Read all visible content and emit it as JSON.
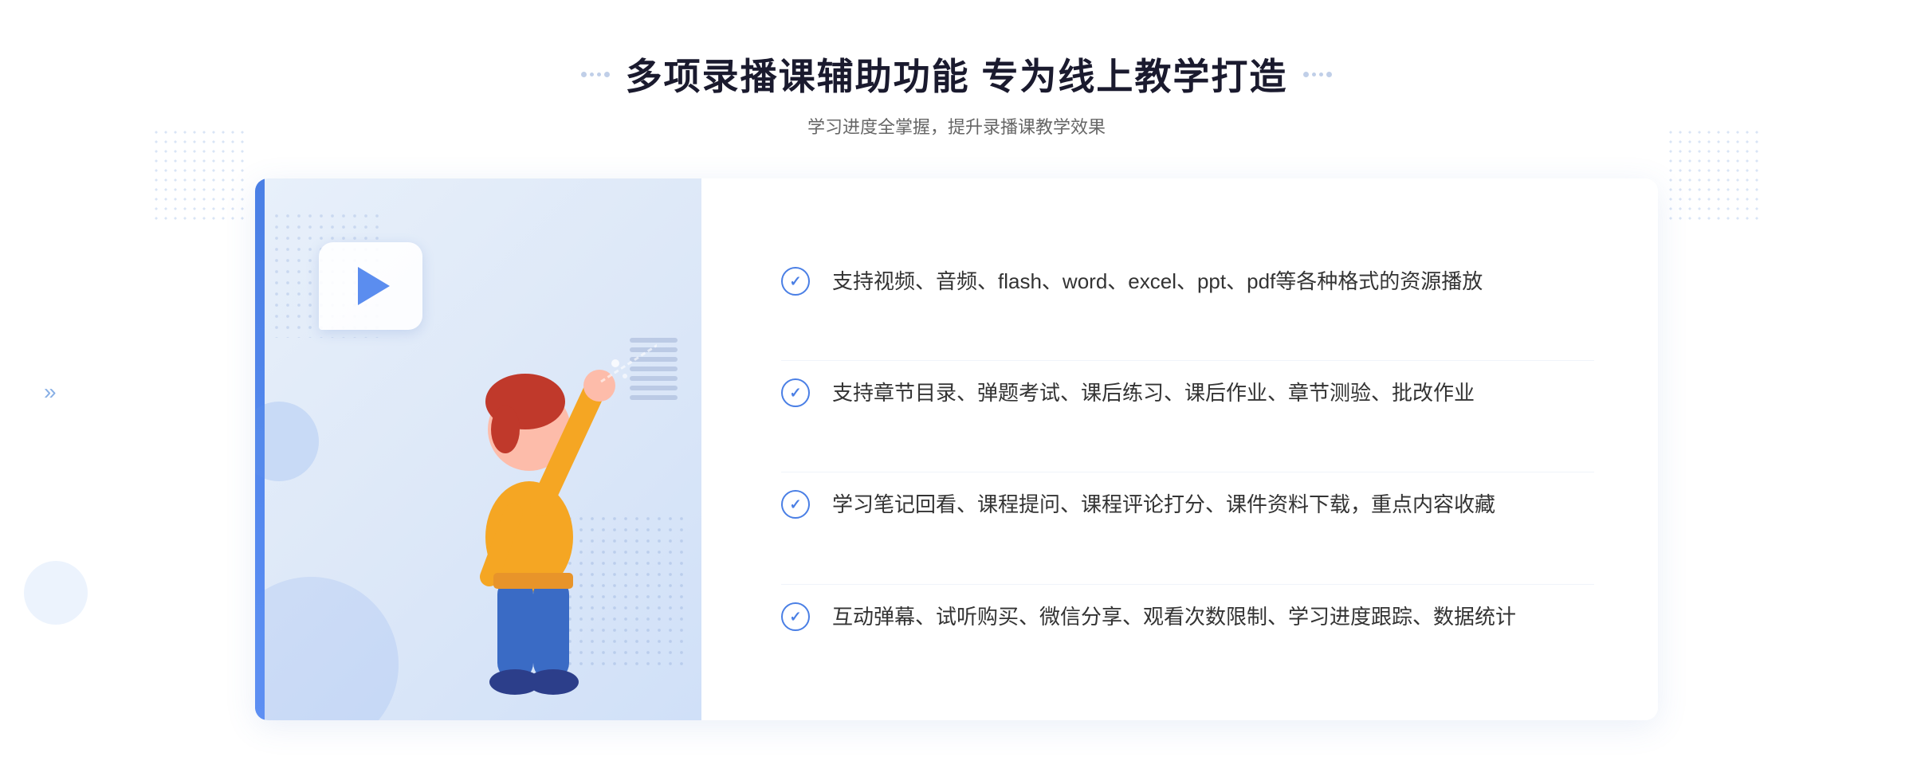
{
  "page": {
    "title": "多项录播课辅助功能 专为线上教学打造",
    "subtitle": "学习进度全掌握，提升录播课教学效果"
  },
  "decorators": {
    "left_dots_label": "grid-dots-left",
    "right_dots_label": "grid-dots-right",
    "left_chevron": "»",
    "play_icon": "▶"
  },
  "features": [
    {
      "id": 1,
      "text": "支持视频、音频、flash、word、excel、ppt、pdf等各种格式的资源播放"
    },
    {
      "id": 2,
      "text": "支持章节目录、弹题考试、课后练习、课后作业、章节测验、批改作业"
    },
    {
      "id": 3,
      "text": "学习笔记回看、课程提问、课程评论打分、课件资料下载，重点内容收藏"
    },
    {
      "id": 4,
      "text": "互动弹幕、试听购买、微信分享、观看次数限制、学习进度跟踪、数据统计"
    }
  ],
  "colors": {
    "accent_blue": "#4a7fe5",
    "light_blue_bg": "#e8f0fa",
    "text_dark": "#1a1a2e",
    "text_gray": "#666666",
    "text_body": "#333333",
    "border_light": "#f0f4fa"
  }
}
